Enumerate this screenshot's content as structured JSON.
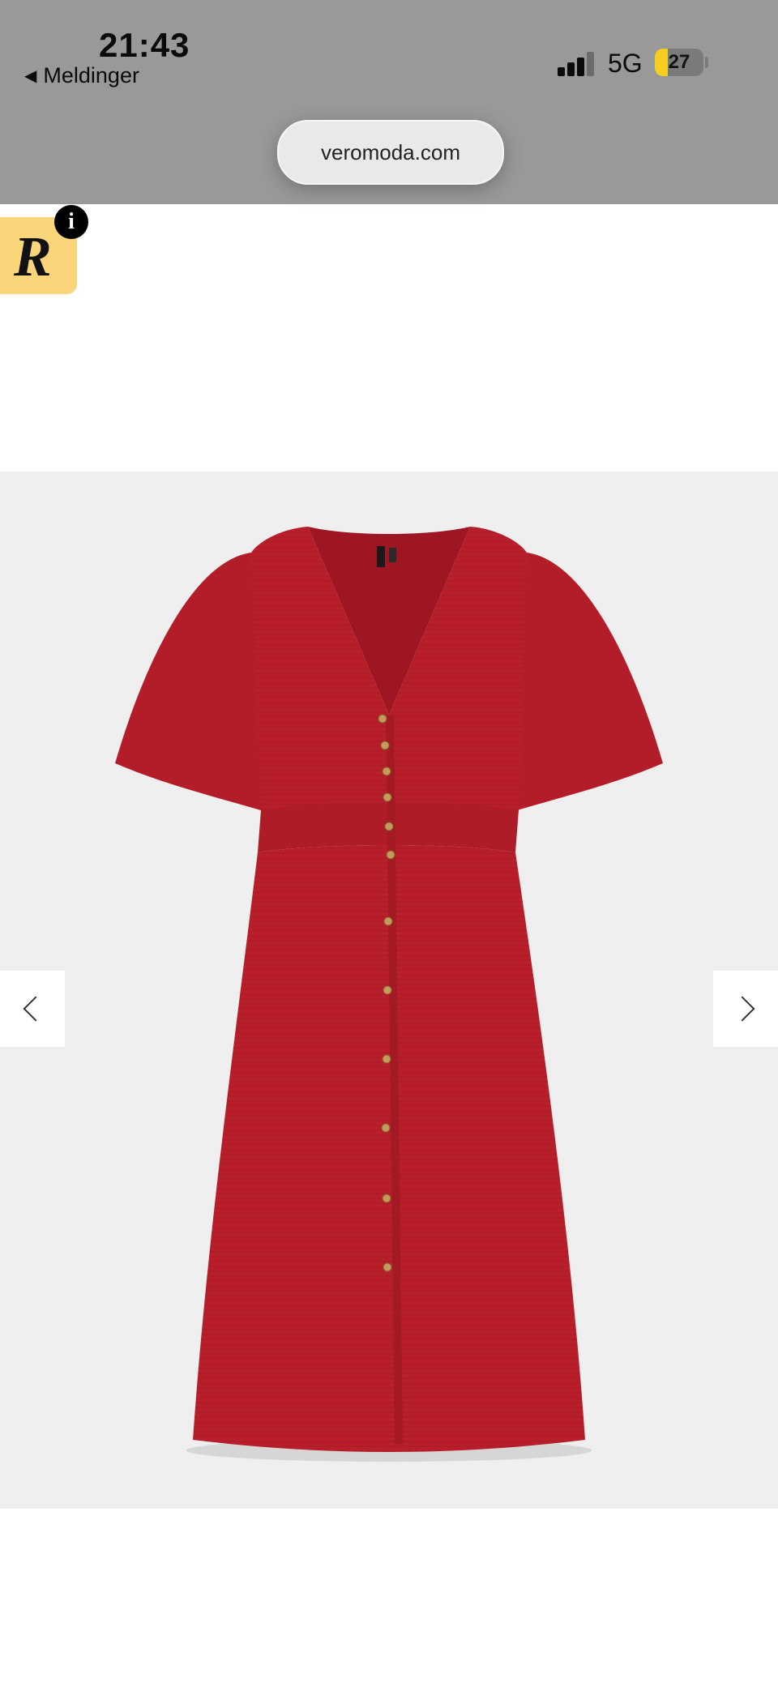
{
  "status_bar": {
    "time": "21:43",
    "back_label": "Meldinger",
    "network": "5G",
    "battery": "27",
    "battery_level": 0.27
  },
  "browser": {
    "url": "veromoda.com"
  },
  "badge": {
    "letter": "R",
    "info": "i"
  },
  "product": {
    "image_alt": "red dress",
    "image_count_visible": 1
  },
  "icons": {
    "back": "back-triangle-icon",
    "signal": "cellular-signal-icon",
    "battery": "battery-icon",
    "prev": "chevron-left-icon",
    "next": "chevron-right-icon",
    "info": "info-icon"
  },
  "colors": {
    "status_bar_bg": "#999999",
    "dress": "#b81f2b",
    "gallery_bg": "#efefef",
    "badge_bg": "#fbd57a"
  }
}
